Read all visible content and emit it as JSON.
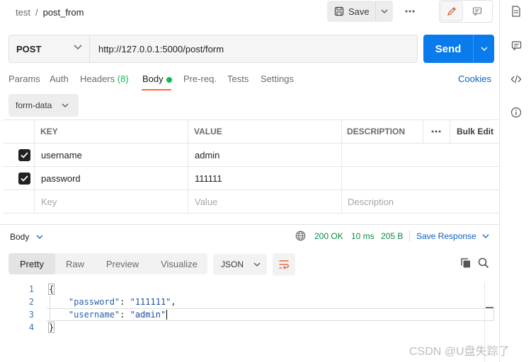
{
  "breadcrumb": {
    "parent": "test",
    "separator": "/",
    "current": "post_from"
  },
  "toolbar": {
    "save_label": "Save",
    "more_icon": "ellipsis-icon"
  },
  "request": {
    "method": "POST",
    "url": "http://127.0.0.1:5000/post/form",
    "send_label": "Send"
  },
  "tabs": {
    "params": "Params",
    "auth": "Auth",
    "headers": "Headers",
    "headers_count": "(8)",
    "body": "Body",
    "prereq": "Pre-req.",
    "tests": "Tests",
    "settings": "Settings",
    "cookies": "Cookies"
  },
  "body_type": "form-data",
  "table": {
    "headers": {
      "key": "KEY",
      "value": "VALUE",
      "description": "DESCRIPTION",
      "bulk_edit": "Bulk Edit"
    },
    "rows": [
      {
        "key": "username",
        "value": "admin",
        "checked": true
      },
      {
        "key": "password",
        "value": "111111",
        "checked": true
      }
    ],
    "placeholder": {
      "key": "Key",
      "value": "Value",
      "description": "Description"
    }
  },
  "response": {
    "section_label": "Body",
    "status": "200 OK",
    "time": "10 ms",
    "size": "205 B",
    "save_label": "Save Response",
    "views": [
      "Pretty",
      "Raw",
      "Preview",
      "Visualize"
    ],
    "active_view": "Pretty",
    "format": "JSON",
    "line_numbers": [
      "1",
      "2",
      "3",
      "4"
    ],
    "json": {
      "open": "{",
      "pw_key": "\"password\"",
      "pw_val": "\"111111\"",
      "un_key": "\"username\"",
      "un_val": "\"admin\"",
      "close": "}"
    }
  },
  "watermark": "CSDN @U盘失踪了",
  "colors": {
    "accent": "#ff6c37",
    "send": "#097bed",
    "success": "#0cbb52",
    "link": "#0b5fc1"
  }
}
